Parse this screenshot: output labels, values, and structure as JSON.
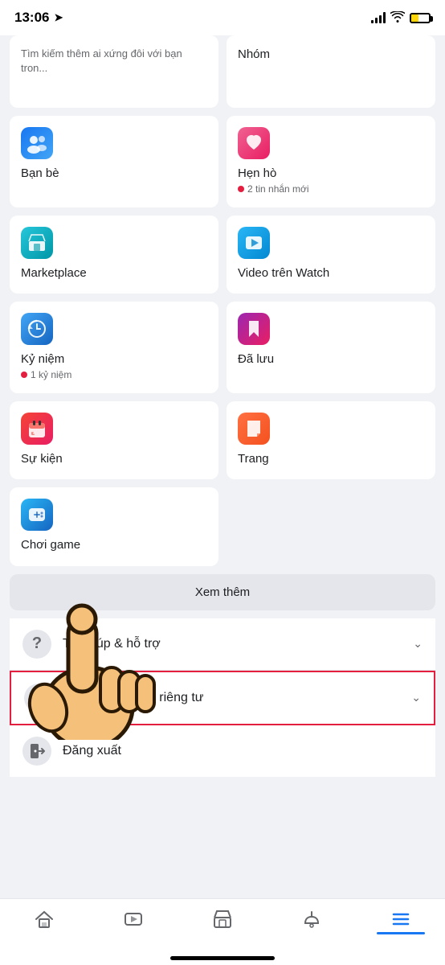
{
  "status_bar": {
    "time": "13:06",
    "navigation_arrow": "➤"
  },
  "top_partial": {
    "left_text": "Tìm kiếm thêm ai xứng đôi với bạn tron...",
    "right_label": "Nhóm"
  },
  "grid_items": [
    {
      "id": "friends",
      "label": "Bạn bè",
      "sublabel": "",
      "icon_type": "friends"
    },
    {
      "id": "dating",
      "label": "Hẹn hò",
      "sublabel": "2 tin nhắn mới",
      "icon_type": "dating"
    },
    {
      "id": "marketplace",
      "label": "Marketplace",
      "sublabel": "",
      "icon_type": "marketplace"
    },
    {
      "id": "watch",
      "label": "Video trên Watch",
      "sublabel": "",
      "icon_type": "watch"
    },
    {
      "id": "memory",
      "label": "Kỷ niệm",
      "sublabel": "1 kỷ niệm",
      "icon_type": "memory"
    },
    {
      "id": "saved",
      "label": "Đã lưu",
      "sublabel": "",
      "icon_type": "saved"
    },
    {
      "id": "events",
      "label": "Sự kiện",
      "sublabel": "",
      "icon_type": "events"
    },
    {
      "id": "pages",
      "label": "Trang",
      "sublabel": "",
      "icon_type": "pages"
    },
    {
      "id": "games",
      "label": "Chơi game",
      "sublabel": "",
      "icon_type": "games"
    }
  ],
  "see_more": "Xem thêm",
  "list_items": [
    {
      "id": "help",
      "label": "Trợ giúp & hỗ trợ",
      "icon": "?"
    },
    {
      "id": "settings",
      "label": "Cài đặt & quyền riêng tư",
      "icon": "⚙",
      "highlighted": true
    },
    {
      "id": "logout",
      "label": "Đăng xuất",
      "icon": "🚪"
    }
  ],
  "bottom_nav": [
    {
      "id": "home",
      "icon": "home",
      "active": false
    },
    {
      "id": "watch",
      "icon": "play",
      "active": false
    },
    {
      "id": "marketplace",
      "icon": "shop",
      "active": false
    },
    {
      "id": "notifications",
      "icon": "bell",
      "active": false
    },
    {
      "id": "menu",
      "icon": "menu",
      "active": true
    }
  ]
}
